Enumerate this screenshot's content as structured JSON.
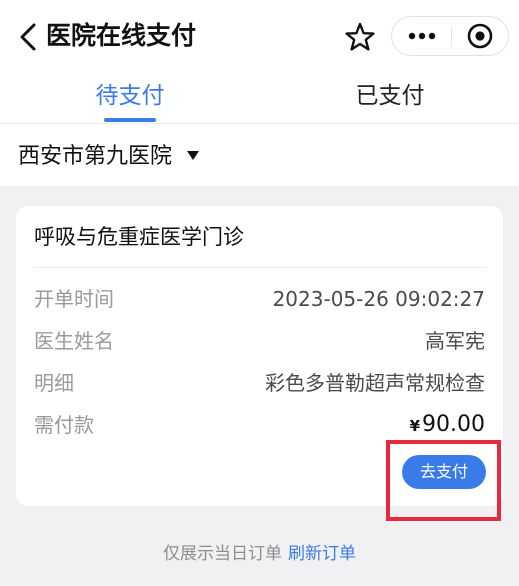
{
  "header": {
    "title": "医院在线支付",
    "icons": {
      "back": "chevron-left-icon",
      "star": "star-icon",
      "more": "more-icon",
      "close": "close-circle-icon"
    }
  },
  "tabs": [
    {
      "label": "待支付",
      "active": true
    },
    {
      "label": "已支付",
      "active": false
    }
  ],
  "hospital": {
    "name": "西安市第九医院",
    "caret_icon": "caret-down-icon"
  },
  "order": {
    "department": "呼吸与危重症医学门诊",
    "rows": [
      {
        "label": "开单时间",
        "value": "2023-05-26 09:02:27"
      },
      {
        "label": "医生姓名",
        "value": "高军宪"
      },
      {
        "label": "明细",
        "value": "彩色多普勒超声常规检查"
      }
    ],
    "amount_label": "需付款",
    "currency": "¥",
    "amount": "90.00",
    "pay_button": "去支付"
  },
  "footer": {
    "note": "仅展示当日订单",
    "refresh_link": "刷新订单"
  },
  "colors": {
    "accent": "#3b7be8",
    "highlight": "#e8283c",
    "background": "#f1f1f3"
  }
}
